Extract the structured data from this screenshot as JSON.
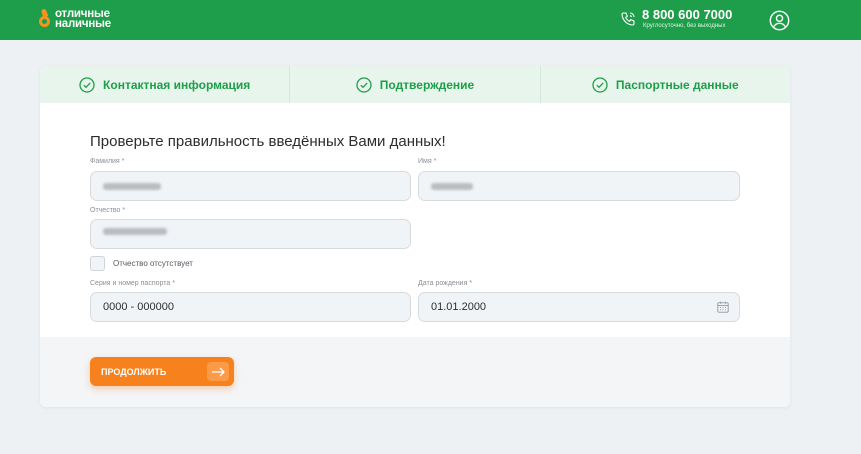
{
  "header": {
    "logo_line1": "отличные",
    "logo_line2": "наличные",
    "phone": "8 800 600 7000",
    "phone_note": "Круглосуточно, без выходных",
    "brand_color": "#1e9e4a",
    "accent_color": "#f7931e"
  },
  "steps": [
    {
      "label": "Контактная информация",
      "icon": "check-circle-icon"
    },
    {
      "label": "Подтверждение",
      "icon": "check-circle-icon"
    },
    {
      "label": "Паспортные данные",
      "icon": "check-circle-icon"
    }
  ],
  "form": {
    "title": "Проверьте правильность введённых Вами данных!",
    "lastname_label": "Фамилия *",
    "firstname_label": "Имя *",
    "patronymic_label": "Отчество *",
    "patronymic_checkbox_label": "Отчество отсутствует",
    "passport_label": "Серия и номер паспорта *",
    "passport_value": "0000 - 000000",
    "birthdate_label": "Дата рождения *",
    "birthdate_value": "01.01.2000"
  },
  "actions": {
    "continue_label": "ПРОДОЛЖИТЬ",
    "button_color": "#f7811c"
  }
}
